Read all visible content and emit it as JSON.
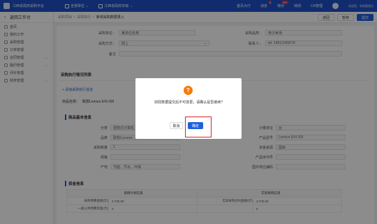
{
  "topbar": {
    "brand": "江西省政府采购平台",
    "org_select": "全部单位",
    "region_select": "江西省政府本级",
    "links": [
      "首页大厅",
      "消息",
      "待办",
      "待阅",
      "CA管理"
    ],
    "msg_count": "8",
    "todo_count": "99+",
    "user": "欢迎您，系统管理员"
  },
  "sidebar": {
    "title": "返回工作台",
    "items": [
      {
        "label": "首页"
      },
      {
        "label": "我的工作"
      },
      {
        "label": "采购管理"
      },
      {
        "label": "订单管理"
      },
      {
        "label": "合同管理",
        "arrow": "⌄"
      },
      {
        "label": "履约管理",
        "arrow": "⌄"
      },
      {
        "label": "评价管理"
      },
      {
        "label": "财务管理",
        "arrow": "⌄"
      }
    ]
  },
  "breadcrumb": {
    "items": [
      "采购项目",
      "采购执行",
      "新增采购数据录入"
    ],
    "buttons": {
      "cancel": "返回",
      "save": "暂存",
      "submit": "提交"
    }
  },
  "form": {
    "unit_label": "采购单位：",
    "unit_value": "某单位名称",
    "category_label": "采购品类：",
    "category_value": "电子卖场",
    "method_label": "采购方式：",
    "method_value": "网上",
    "contact_label": "联系人：",
    "contact_value": "tel: 18612345678",
    "remark_label": "备注",
    "remark_value": ""
  },
  "section1": {
    "title": "采购执行情况列表",
    "link": "+ 添加采购执行信息",
    "item_label": "商品名称：",
    "item_value": "联想Lenovo E41-50I"
  },
  "section2": {
    "title": "商品基本信息",
    "rows": [
      {
        "label": "分类",
        "value": "便携式计算机",
        "label2": "计量单位",
        "value2": "台"
      },
      {
        "label": "品牌",
        "value": "联想/Lenovo",
        "label2": "产品型号",
        "value2": "Lenovo E41-50I"
      },
      {
        "label": "采购数量",
        "value": "1",
        "label2": "资金来源",
        "value2": "国库"
      },
      {
        "label": "规格",
        "value": "",
        "label2": "产品序列号",
        "value2": ""
      },
      {
        "label": "产地",
        "value": "节能、节水、环保",
        "label2": "国外供应编码",
        "value2": ""
      }
    ]
  },
  "section3": {
    "title": "资金信息",
    "table": {
      "headers": [
        "采购计划信息",
        "实际采购信息"
      ],
      "row1": [
        "采购预算金额(元)",
        "3,700.00",
        "实际采购合同金额(元)",
        "3,700.00"
      ],
      "row2": [
        "一般公共预算资金(元)",
        "0",
        "",
        "0"
      ]
    }
  },
  "modal": {
    "icon": "?",
    "message": "财政数据提交后不可变更，请确认是否继续?",
    "cancel": "取消",
    "confirm": "确定"
  }
}
